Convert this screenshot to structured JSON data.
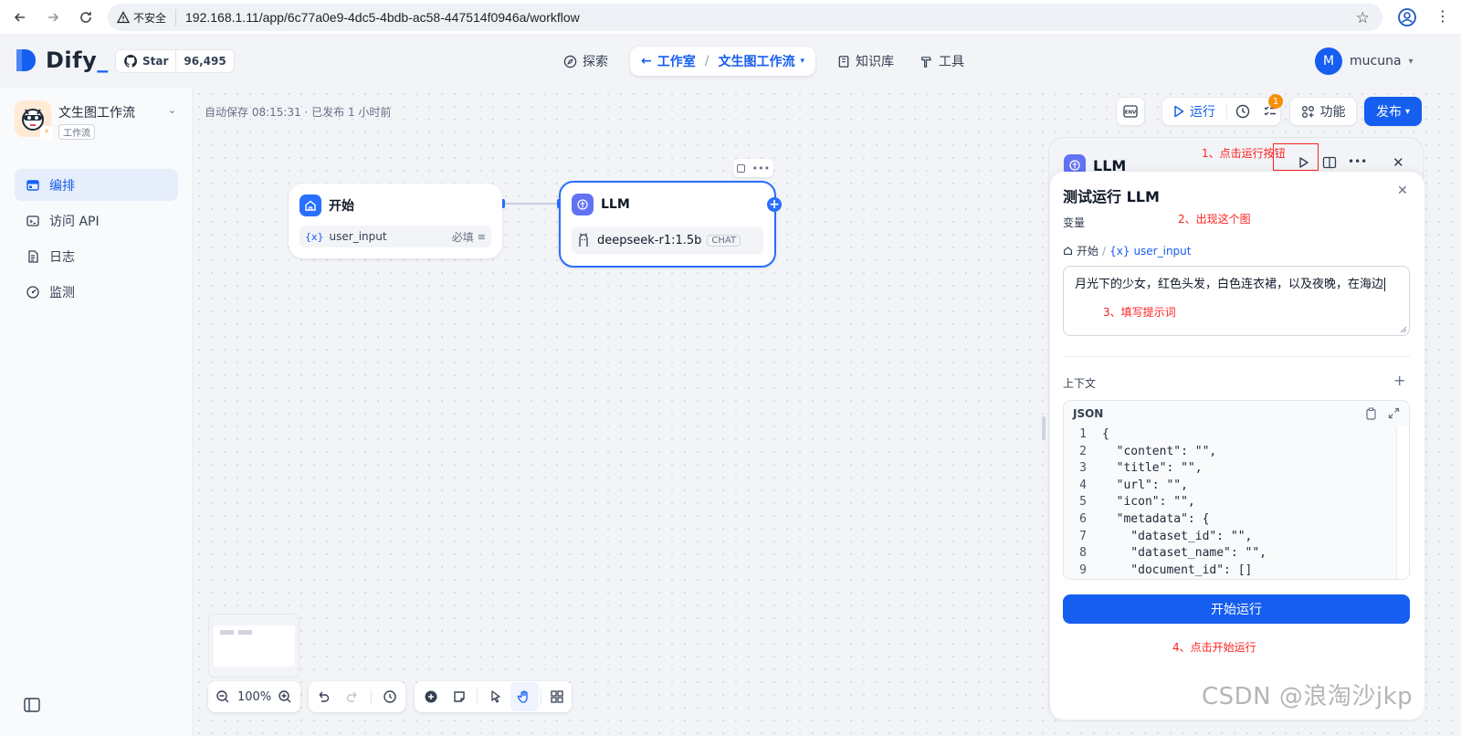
{
  "browser": {
    "insecure_label": "不安全",
    "url": "192.168.1.11/app/6c77a0e9-4dc5-4bdb-ac58-447514f0946a/workflow"
  },
  "header": {
    "logo": "Dify",
    "github_star_label": "Star",
    "github_star_count": "96,495",
    "nav": {
      "explore": "探索",
      "studio": "工作室",
      "current_app": "文生图工作流",
      "knowledge": "知识库",
      "tools": "工具"
    },
    "user_initial": "M",
    "user_name": "mucuna"
  },
  "sidebar": {
    "app_name": "文生图工作流",
    "app_type": "工作流",
    "items": [
      {
        "label": "编排",
        "icon": "orchestrate-icon",
        "active": true
      },
      {
        "label": "访问 API",
        "icon": "terminal-icon",
        "active": false
      },
      {
        "label": "日志",
        "icon": "log-icon",
        "active": false
      },
      {
        "label": "监测",
        "icon": "monitor-icon",
        "active": false
      }
    ]
  },
  "canvas": {
    "autosave": "自动保存 08:15:31 · 已发布 1 小时前",
    "toolbar": {
      "env": "ENV",
      "run": "运行",
      "badge": "1",
      "features": "功能",
      "publish": "发布"
    },
    "nodes": {
      "start": {
        "title": "开始",
        "var_mark": "{x}",
        "var_name": "user_input",
        "required": "必填"
      },
      "llm": {
        "title": "LLM",
        "model": "deepseek-r1:1.5b",
        "mode": "CHAT"
      }
    },
    "zoom": "100%"
  },
  "llm_panel": {
    "title": "LLM",
    "test": {
      "title": "测试运行 LLM",
      "variables_label": "变量",
      "breadcrumb_node": "开始",
      "breadcrumb_var_mark": "{x}",
      "breadcrumb_var": "user_input",
      "prompt_value": "月光下的少女，红色头发，白色连衣裙，以及夜晚，在海边",
      "context_label": "上下文",
      "json_label": "JSON",
      "json_lines": [
        "{",
        "  \"content\": \"\",",
        "  \"title\": \"\",",
        "  \"url\": \"\",",
        "  \"icon\": \"\",",
        "  \"metadata\": {",
        "    \"dataset_id\": \"\",",
        "    \"dataset_name\": \"\",",
        "    \"document_id\": []"
      ],
      "start_button": "开始运行"
    }
  },
  "annotations": {
    "step1": "1、点击运行按钮",
    "step2": "2、出现这个图",
    "step3": "3、填写提示词",
    "step4": "4、点击开始运行"
  },
  "watermark": "CSDN @浪淘沙jkp",
  "colors": {
    "accent": "#155eef",
    "annotation": "#ff2020",
    "badge": "#f79009"
  }
}
